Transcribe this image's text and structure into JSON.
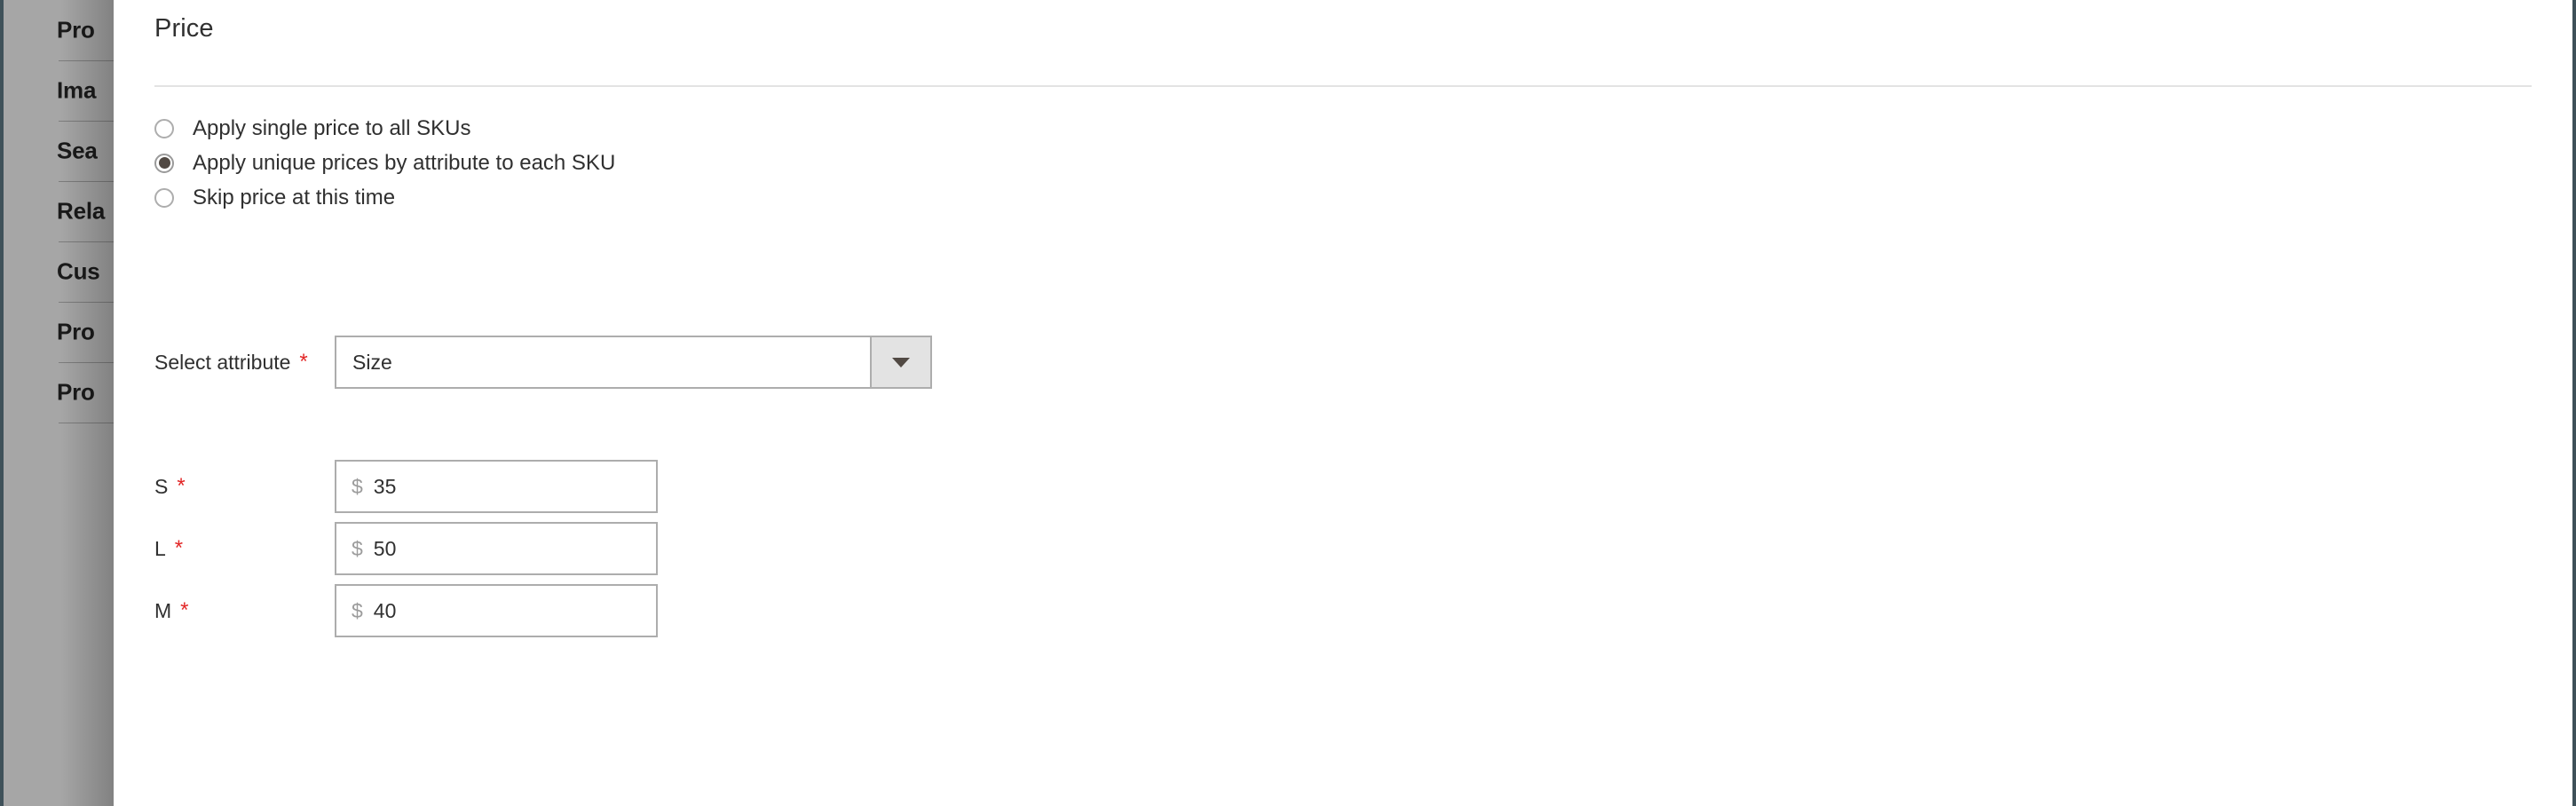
{
  "window": {
    "frame_border_color": "#3f5159"
  },
  "backdrop": {
    "overlay_color": "#a6a6a6",
    "sidebar_items": [
      {
        "label": "Pro"
      },
      {
        "label": "Ima"
      },
      {
        "label": "Sea"
      },
      {
        "label": "Rela"
      },
      {
        "label": "Cus"
      },
      {
        "label": "Pro"
      },
      {
        "label": "Pro"
      }
    ]
  },
  "panel": {
    "title": "Price",
    "price_mode": {
      "options": [
        {
          "label": "Apply single price to all SKUs",
          "selected": false
        },
        {
          "label": "Apply unique prices by attribute to each SKU",
          "selected": true
        },
        {
          "label": "Skip price at this time",
          "selected": false
        }
      ]
    },
    "attribute_field": {
      "label": "Select attribute",
      "required_marker": "*",
      "value": "Size",
      "dropdown_icon": "chevron-down-icon"
    },
    "sku_prices": [
      {
        "label": "S",
        "required_marker": "*",
        "currency": "$",
        "value": "35"
      },
      {
        "label": "L",
        "required_marker": "*",
        "currency": "$",
        "value": "50"
      },
      {
        "label": "M",
        "required_marker": "*",
        "currency": "$",
        "value": "40"
      }
    ]
  },
  "colors": {
    "required_red": "#e22626",
    "radio_dot": "#514943",
    "text": "#303030",
    "border": "#adadad",
    "rule": "#e3e3e3",
    "currency_grey": "#9c9c9c"
  }
}
